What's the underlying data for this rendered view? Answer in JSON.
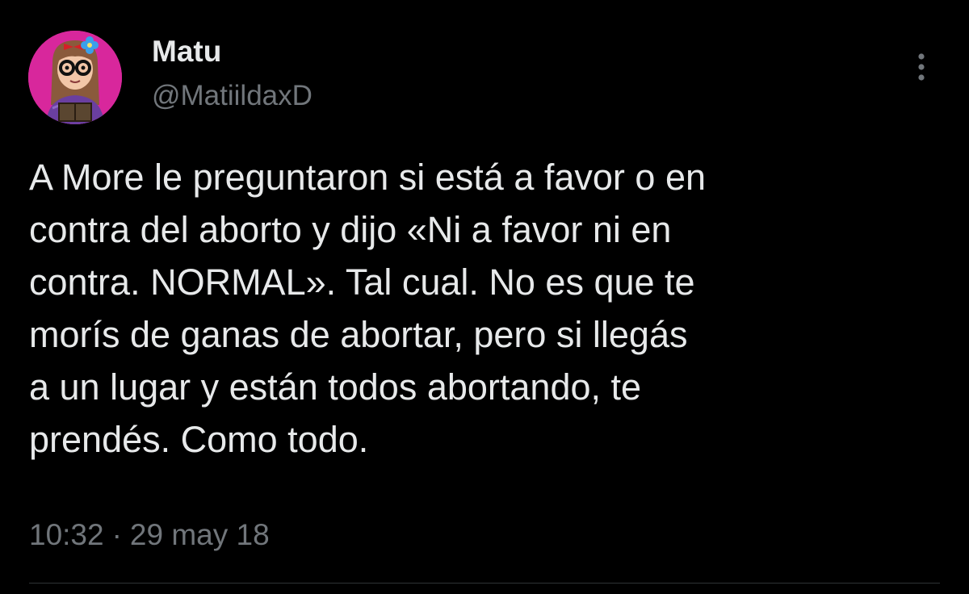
{
  "tweet": {
    "author": {
      "display_name": "Matu",
      "handle": "@MatiildaxD",
      "avatar_icon": "cartoon-girl-avatar-icon"
    },
    "more_icon": "more-vertical-icon",
    "text_lines": [
      "A More le preguntaron si está a favor o en",
      "contra del aborto y dijo «Ni a favor ni en",
      "contra. NORMAL». Tal cual. No es que te",
      "morís de ganas de abortar, pero si llegás",
      "a un lugar y están todos abortando, te",
      "prendés. Como todo."
    ],
    "time": "10:32",
    "separator": "·",
    "date": "29 may 18"
  },
  "colors": {
    "background": "#000000",
    "primary_text": "#e7e9ea",
    "secondary_text": "#71767b",
    "avatar_bg": "#d8279c",
    "divider": "#2f3336"
  }
}
